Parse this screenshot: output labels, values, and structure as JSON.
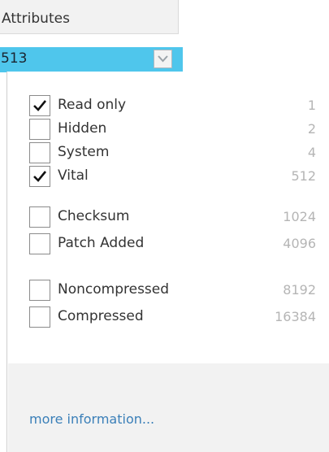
{
  "header": {
    "label": "Attributes"
  },
  "combo": {
    "value": "513",
    "button_icon": "chevron-down-icon"
  },
  "items": [
    {
      "label": "Read only",
      "value": "1",
      "checked": true
    },
    {
      "label": "Hidden",
      "value": "2",
      "checked": false
    },
    {
      "label": "System",
      "value": "4",
      "checked": false
    },
    {
      "label": "Vital",
      "value": "512",
      "checked": true
    },
    {
      "label": "Checksum",
      "value": "1024",
      "checked": false
    },
    {
      "label": "Patch Added",
      "value": "4096",
      "checked": false
    },
    {
      "label": "Noncompressed",
      "value": "8192",
      "checked": false
    },
    {
      "label": "Compressed",
      "value": "16384",
      "checked": false
    }
  ],
  "footer": {
    "link": "more information..."
  },
  "colors": {
    "combo_background": "#4fc6ec",
    "link": "#3a7fb8",
    "value_text": "#b5b5b5"
  }
}
